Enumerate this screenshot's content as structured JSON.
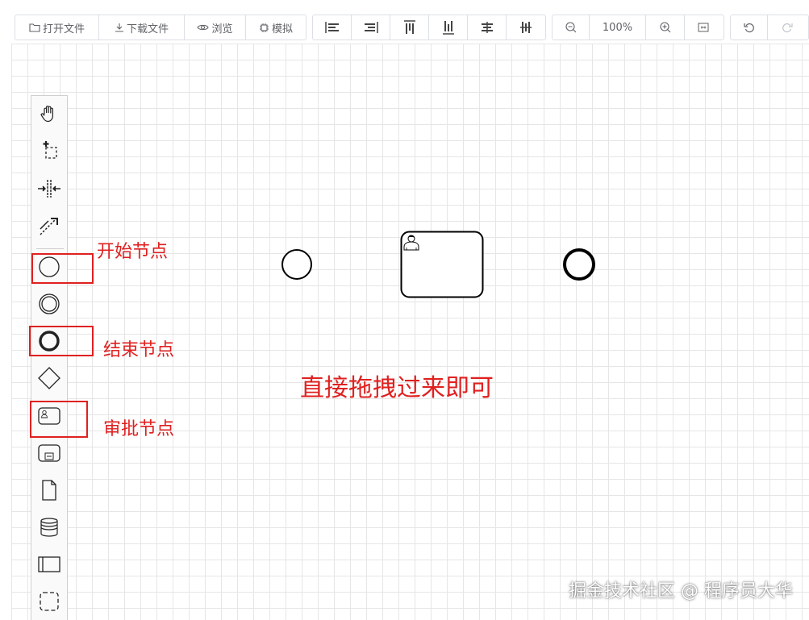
{
  "toolbar": {
    "file_group": {
      "open_label": "打开文件",
      "download_label": "下载文件",
      "preview_label": "浏览",
      "simulate_label": "模拟"
    },
    "align_group": [
      "align-left-icon",
      "align-right-icon",
      "align-top-icon",
      "align-bottom-icon",
      "align-center-icon",
      "align-middle-icon"
    ],
    "zoom_group": {
      "zoom_level": "100%"
    },
    "history_group": [
      "undo-icon",
      "redo-icon"
    ]
  },
  "palette": {
    "tools": [
      "hand-tool-icon",
      "lasso-tool-icon",
      "space-tool-icon",
      "connect-tool-icon",
      "start-event-icon",
      "intermediate-event-icon",
      "end-event-icon",
      "gateway-icon",
      "user-task-icon",
      "subprocess-icon",
      "data-object-icon",
      "data-store-icon",
      "pool-icon",
      "group-icon"
    ]
  },
  "annotations": {
    "start_node": "开始节点",
    "end_node": "结束节点",
    "approval_node": "审批节点",
    "drag_hint": "直接拖拽过来即可"
  },
  "watermark": "掘金技术社区 @ 程序员大华",
  "colors": {
    "annotation": "#e02020",
    "grid": "#e6e6e6"
  }
}
